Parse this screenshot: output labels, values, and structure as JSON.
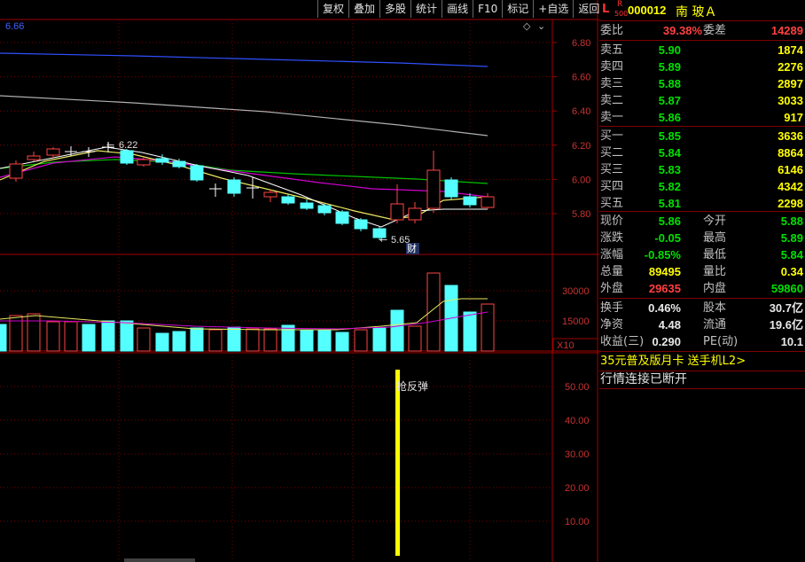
{
  "toolbar": {
    "buttons": [
      "复权",
      "叠加",
      "多股",
      "统计",
      "画线",
      "F10",
      "标记",
      "+自选",
      "返回"
    ]
  },
  "main_chart": {
    "ma_top_label": "6.66",
    "price_axis": [
      "6.80",
      "6.60",
      "6.40",
      "6.20",
      "6.00",
      "5.80"
    ],
    "high_marker": "6.22",
    "low_marker": "5.65",
    "finance_badge": "财",
    "volume_axis": [
      "30000",
      "15000"
    ],
    "volume_unit": "X10",
    "indicator_axis": [
      "50.00",
      "40.00",
      "30.00",
      "20.00",
      "10.00"
    ],
    "signal_label": "抢反弹",
    "signal_value": 55
  },
  "quote": {
    "header": {
      "prefix": "L",
      "badge_top": "R",
      "badge_bottom": "500",
      "code": "000012",
      "name": "南 玻Ａ"
    },
    "weibi": {
      "label": "委比",
      "value": "39.38%",
      "label2": "委差",
      "value2": "14289"
    },
    "asks": [
      {
        "label": "卖五",
        "price": "5.90",
        "vol": "1874"
      },
      {
        "label": "卖四",
        "price": "5.89",
        "vol": "2276"
      },
      {
        "label": "卖三",
        "price": "5.88",
        "vol": "2897"
      },
      {
        "label": "卖二",
        "price": "5.87",
        "vol": "3033"
      },
      {
        "label": "卖一",
        "price": "5.86",
        "vol": "917"
      }
    ],
    "bids": [
      {
        "label": "买一",
        "price": "5.85",
        "vol": "3636"
      },
      {
        "label": "买二",
        "price": "5.84",
        "vol": "8864"
      },
      {
        "label": "买三",
        "price": "5.83",
        "vol": "6146"
      },
      {
        "label": "买四",
        "price": "5.82",
        "vol": "4342"
      },
      {
        "label": "买五",
        "price": "5.81",
        "vol": "2298"
      }
    ],
    "stats": [
      {
        "l1": "现价",
        "v1": "5.86",
        "c1": "green",
        "l2": "今开",
        "v2": "5.88",
        "c2": "green"
      },
      {
        "l1": "涨跌",
        "v1": "-0.05",
        "c1": "green",
        "l2": "最高",
        "v2": "5.89",
        "c2": "green"
      },
      {
        "l1": "涨幅",
        "v1": "-0.85%",
        "c1": "green",
        "l2": "最低",
        "v2": "5.84",
        "c2": "green"
      },
      {
        "l1": "总量",
        "v1": "89495",
        "c1": "yellow",
        "l2": "量比",
        "v2": "0.34",
        "c2": "yellow"
      },
      {
        "l1": "外盘",
        "v1": "29635",
        "c1": "red",
        "l2": "内盘",
        "v2": "59860",
        "c2": "green"
      }
    ],
    "fundamentals": [
      {
        "l1": "换手",
        "v1": "0.46%",
        "l2": "股本",
        "v2": "30.7亿"
      },
      {
        "l1": "净资",
        "v1": "4.48",
        "l2": "流通",
        "v2": "19.6亿"
      },
      {
        "l1": "收益(三)",
        "v1": "0.290",
        "l2": "PE(动)",
        "v2": "10.1"
      }
    ],
    "ad": "35元普及版月卡 送手机L2>",
    "status": "行情连接已断开"
  }
}
